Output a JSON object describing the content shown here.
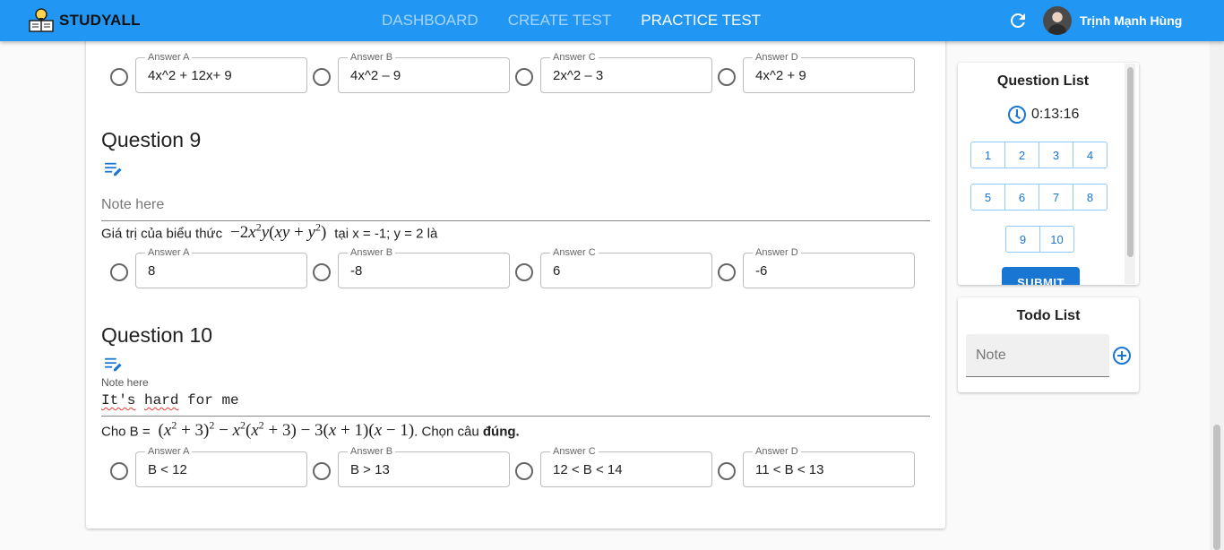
{
  "app": {
    "brand": "STUDYALL",
    "nav": [
      {
        "label": "DASHBOARD",
        "active": false
      },
      {
        "label": "CREATE TEST",
        "active": false
      },
      {
        "label": "PRACTICE TEST",
        "active": true
      }
    ],
    "user_name": "Trịnh Mạnh Hùng",
    "accent_color": "#2196f3"
  },
  "questions": {
    "q8": {
      "answers": [
        {
          "label": "Answer A",
          "value": "4x^2 + 12x+ 9"
        },
        {
          "label": "Answer B",
          "value": "4x^2 – 9"
        },
        {
          "label": "Answer C",
          "value": "2x^2 – 3"
        },
        {
          "label": "Answer D",
          "value": "4x^2 + 9"
        }
      ]
    },
    "q9": {
      "title": "Question 9",
      "note_placeholder": "Note here",
      "text_before": "Giá trị của biểu thức",
      "text_after": "tại x = -1; y = 2 là",
      "answers": [
        {
          "label": "Answer A",
          "value": "8"
        },
        {
          "label": "Answer B",
          "value": "-8"
        },
        {
          "label": "Answer C",
          "value": "6"
        },
        {
          "label": "Answer D",
          "value": "-6"
        }
      ]
    },
    "q10": {
      "title": "Question 10",
      "note_label": "Note here",
      "note_value_word1": "It's",
      "note_value_word2": "hard",
      "note_value_rest": "for me",
      "text_before": "Cho B =",
      "text_after": ". Chọn câu",
      "text_bold": "đúng.",
      "answers": [
        {
          "label": "Answer A",
          "value": "B < 12"
        },
        {
          "label": "Answer B",
          "value": "B > 13"
        },
        {
          "label": "Answer C",
          "value": "12 < B < 14"
        },
        {
          "label": "Answer D",
          "value": "11 < B < 13"
        }
      ]
    }
  },
  "sidebar": {
    "question_list_title": "Question List",
    "timer": "0:13:16",
    "question_numbers": [
      "1",
      "2",
      "3",
      "4",
      "5",
      "6",
      "7",
      "8",
      "9",
      "10"
    ],
    "submit_label": "SUBMIT",
    "todo_title": "Todo List",
    "todo_placeholder": "Note"
  }
}
